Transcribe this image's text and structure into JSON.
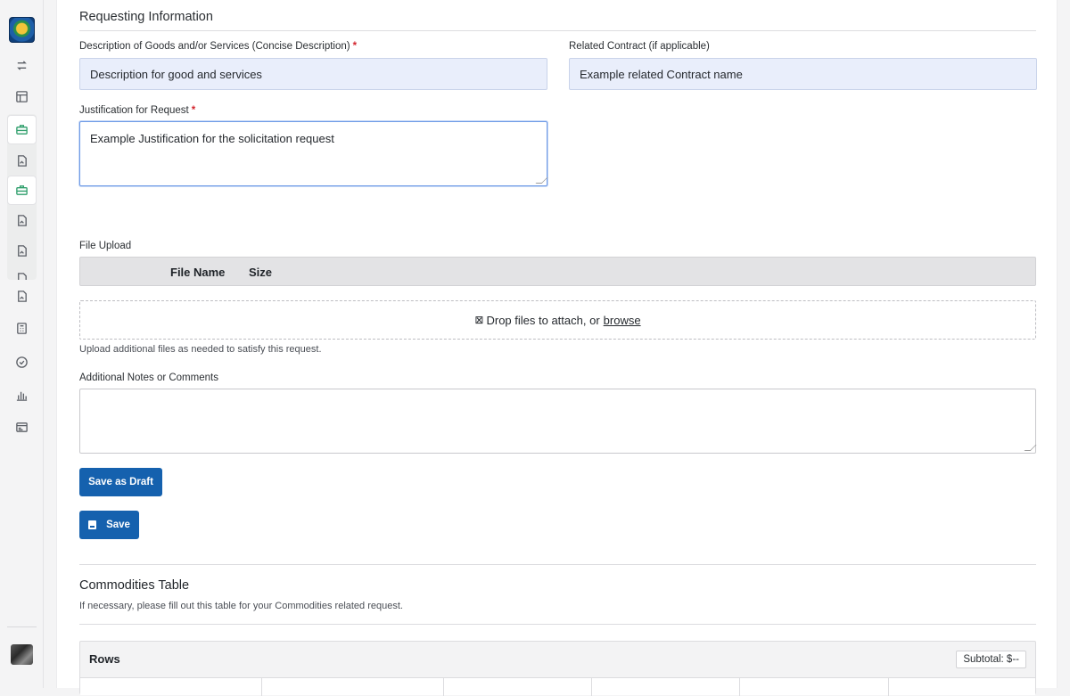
{
  "sidebar": {
    "logo_alt": "Seal",
    "icons": [
      {
        "name": "transfer-icon"
      },
      {
        "name": "layout-icon"
      },
      {
        "name": "briefcase-icon",
        "active": true
      },
      {
        "name": "document-icon"
      },
      {
        "name": "briefcase-icon",
        "active": true
      },
      {
        "name": "document-icon"
      },
      {
        "name": "document-icon"
      },
      {
        "name": "document-icon"
      },
      {
        "name": "calculator-icon"
      },
      {
        "name": "check-circle-icon"
      },
      {
        "name": "bar-chart-icon"
      },
      {
        "name": "list-card-icon"
      }
    ]
  },
  "form": {
    "section_title": "Requesting Information",
    "description_label": "Description of Goods and/or Services (Concise Description)",
    "description_value": "Description for good and services",
    "related_contract_label": "Related Contract (if applicable)",
    "related_contract_value": "Example related Contract name",
    "justification_label": "Justification for Request",
    "justification_value": "Example Justification for the solicitation request",
    "required_mark": "*",
    "file_upload_label": "File Upload",
    "file_columns": [
      "File Name",
      "Size"
    ],
    "dropzone_icon": "⊠",
    "dropzone_text": "Drop files to attach, or",
    "dropzone_link": "browse",
    "upload_help": "Upload additional files as needed to satisfy this request.",
    "notes_label": "Additional Notes or Comments",
    "notes_value": "",
    "save_draft_label": "Save as Draft",
    "save_label": "Save"
  },
  "commodities": {
    "title": "Commodities Table",
    "subtitle": "If necessary, please fill out this table for your Commodities related request.",
    "rows_title": "Rows",
    "subtotal": "Subtotal: $--"
  },
  "colors": {
    "primary": "#1561ae",
    "active_icon": "#2e9e6b",
    "required": "#d3262f",
    "input_fill": "#e9eefb"
  }
}
